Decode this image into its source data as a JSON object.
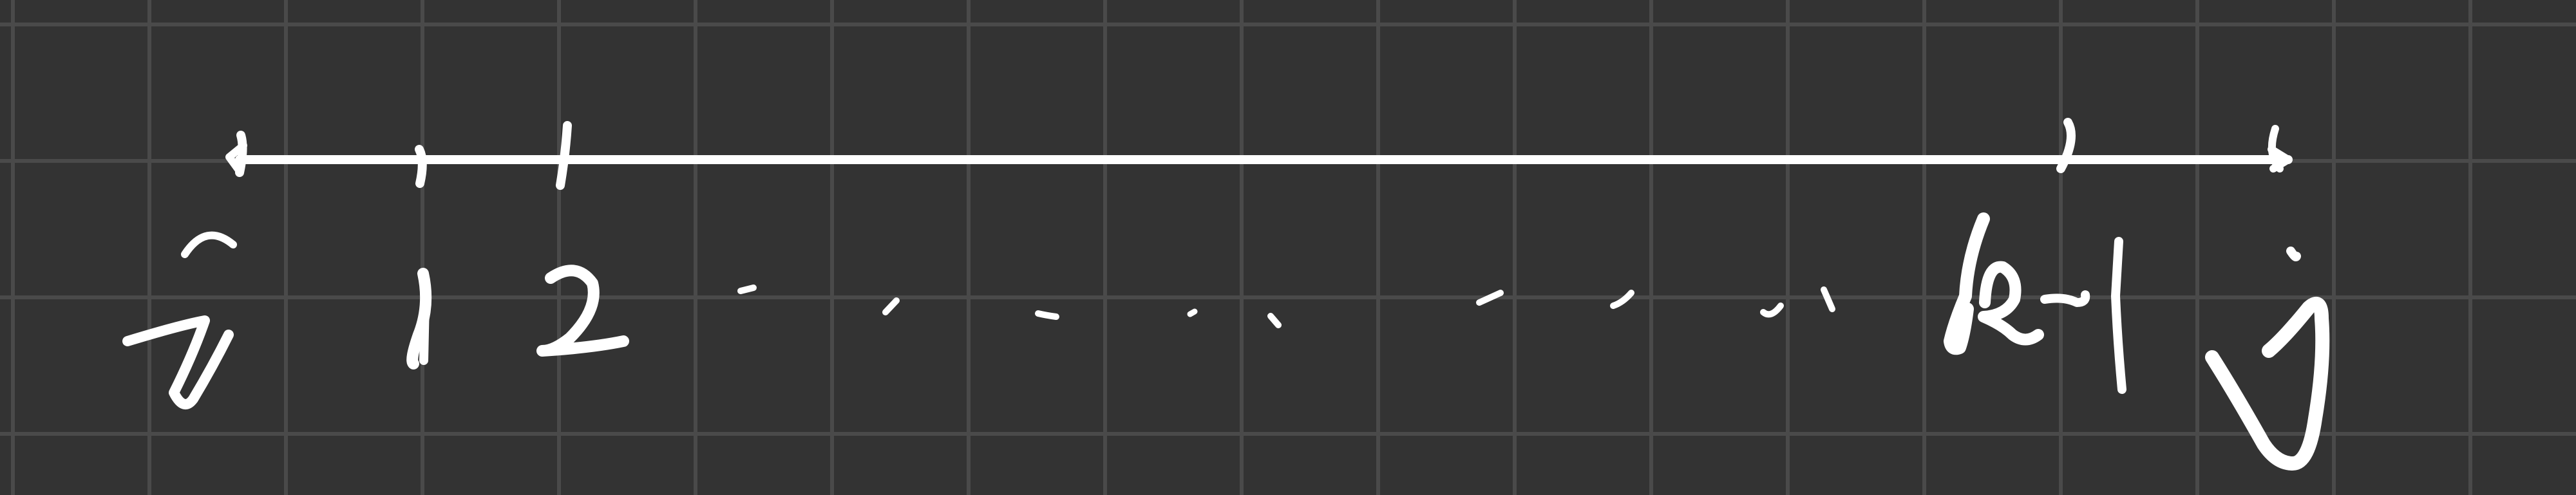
{
  "colors": {
    "background": "#333333",
    "grid": "#4a4a4a",
    "ink": "#ffffff"
  },
  "number_line": {
    "labels": {
      "zero": "0",
      "one": "1",
      "two": "2",
      "k_minus_one": "k-1",
      "k": "k"
    }
  }
}
